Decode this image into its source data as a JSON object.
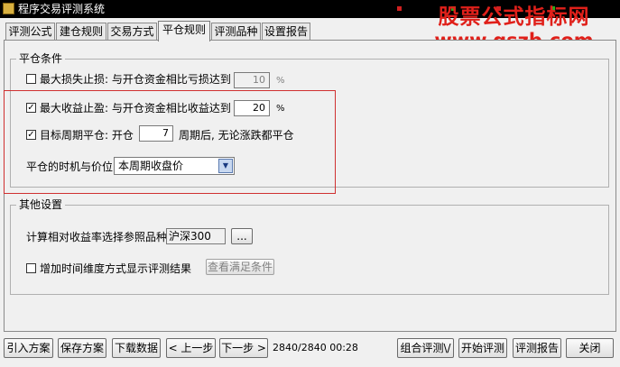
{
  "window": {
    "title": "程序交易评测系统"
  },
  "watermark": {
    "line1": "股票公式指标网",
    "line2": "www.gszb.com"
  },
  "colors": {
    "accent_red": "#e0201a",
    "highlight_box": "#d03030",
    "ticker_red": "#d02020",
    "ticker_green": "#20b020"
  },
  "tabs": [
    {
      "label": "评测公式"
    },
    {
      "label": "建仓规则"
    },
    {
      "label": "交易方式"
    },
    {
      "label": "平仓规则",
      "active": true
    },
    {
      "label": "评测品种"
    },
    {
      "label": "设置报告"
    }
  ],
  "close_conditions": {
    "legend": "平仓条件",
    "stop_loss": {
      "checked": false,
      "label": "最大损失止损: 与开仓资金相比亏损达到",
      "value": "10",
      "unit": "%"
    },
    "take_profit": {
      "checked": true,
      "label": "最大收益止盈: 与开仓资金相比收益达到",
      "value": "20",
      "unit": "%"
    },
    "target_period": {
      "checked": true,
      "label": "目标周期平仓: 开仓",
      "value": "7",
      "suffix": "周期后, 无论涨跌都平仓"
    },
    "timing": {
      "label": "平仓的时机与价位",
      "selected": "本周期收盘价"
    }
  },
  "other_settings": {
    "legend": "其他设置",
    "reference": {
      "label": "计算相对收益率选择参照品种",
      "value": "沪深300",
      "browse": "..."
    },
    "time_dimension": {
      "checked": false,
      "label": "增加时间维度方式显示评测结果",
      "button": "查看满足条件"
    }
  },
  "footer": {
    "import": "引入方案",
    "save": "保存方案",
    "download": "下载数据",
    "prev": "< 上一步",
    "next": "下一步 >",
    "status": "2840/2840 00:28",
    "combo": "组合评测\\/",
    "start": "开始评测",
    "report": "评测报告",
    "close": "关闭"
  },
  "icons": {
    "checkbox_checked": "✓",
    "dropdown": "▼"
  }
}
